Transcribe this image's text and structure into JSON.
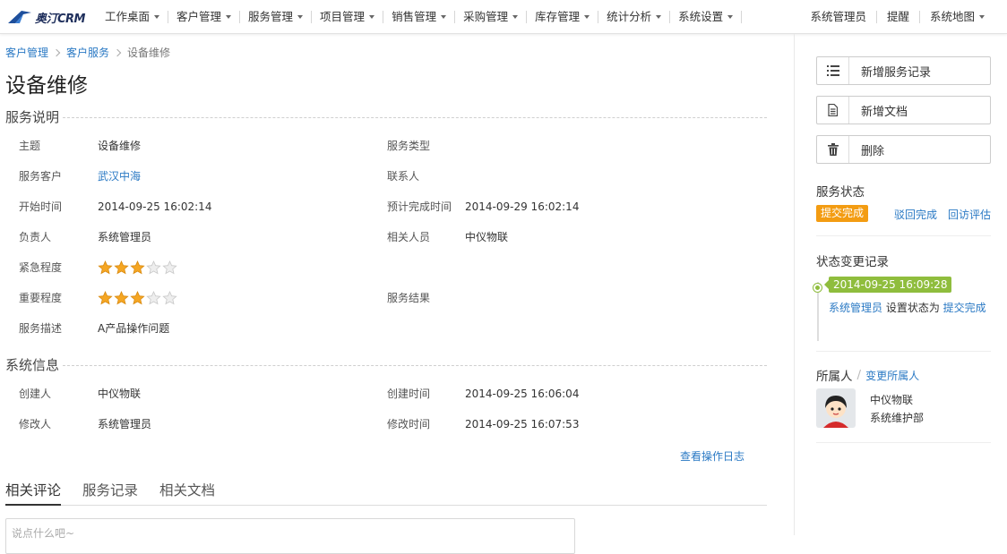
{
  "app": {
    "logo_text": "奥汀CRM"
  },
  "nav": {
    "menu": [
      "工作桌面",
      "客户管理",
      "服务管理",
      "项目管理",
      "销售管理",
      "采购管理",
      "库存管理",
      "统计分析",
      "系统设置"
    ],
    "right": [
      "系统管理员",
      "提醒",
      "系统地图"
    ]
  },
  "breadcrumb": [
    "客户管理",
    "客户服务",
    "设备维修"
  ],
  "page_title": "设备维修",
  "service_section": {
    "title": "服务说明",
    "fields": {
      "subject": {
        "label": "主题",
        "value": "设备维修"
      },
      "service_type": {
        "label": "服务类型",
        "value": ""
      },
      "customer": {
        "label": "服务客户",
        "value": "武汉中海"
      },
      "contact": {
        "label": "联系人",
        "value": ""
      },
      "start_time": {
        "label": "开始时间",
        "value": "2014-09-25 16:02:14"
      },
      "expected_end": {
        "label": "预计完成时间",
        "value": "2014-09-29 16:02:14"
      },
      "owner": {
        "label": "负责人",
        "value": "系统管理员"
      },
      "related_people": {
        "label": "相关人员",
        "value": "中仪物联"
      },
      "urgency": {
        "label": "紧急程度",
        "rating": 3,
        "max": 5
      },
      "importance": {
        "label": "重要程度",
        "rating": 3,
        "max": 5
      },
      "result": {
        "label": "服务结果",
        "value": ""
      },
      "description": {
        "label": "服务描述",
        "value": "A产品操作问题"
      }
    }
  },
  "system_section": {
    "title": "系统信息",
    "fields": {
      "creator": {
        "label": "创建人",
        "value": "中仪物联"
      },
      "created_time": {
        "label": "创建时间",
        "value": "2014-09-25 16:06:04"
      },
      "modifier": {
        "label": "修改人",
        "value": "系统管理员"
      },
      "modified_time": {
        "label": "修改时间",
        "value": "2014-09-25 16:07:53"
      }
    }
  },
  "oplog_link": "查看操作日志",
  "tabs": [
    "相关评论",
    "服务记录",
    "相关文档"
  ],
  "comment_placeholder": "说点什么吧~",
  "sidebar": {
    "buttons": {
      "add_record": "新增服务记录",
      "add_doc": "新增文档",
      "delete": "删除"
    },
    "status": {
      "title": "服务状态",
      "current": "提交完成",
      "actions": [
        "驳回完成",
        "回访评估"
      ]
    },
    "history": {
      "title": "状态变更记录",
      "time": "2014-09-25 16:09:28",
      "actor": "系统管理员",
      "action_text": " 设置状态为 ",
      "new_status": "提交完成"
    },
    "owner": {
      "title": "所属人",
      "change_link": "变更所属人",
      "name": "中仪物联",
      "dept": "系统维护部"
    }
  },
  "colors": {
    "link": "#2a79c4",
    "status_badge": "#f39c12",
    "timeline": "#8fbd3d",
    "star": "#f5a623"
  }
}
